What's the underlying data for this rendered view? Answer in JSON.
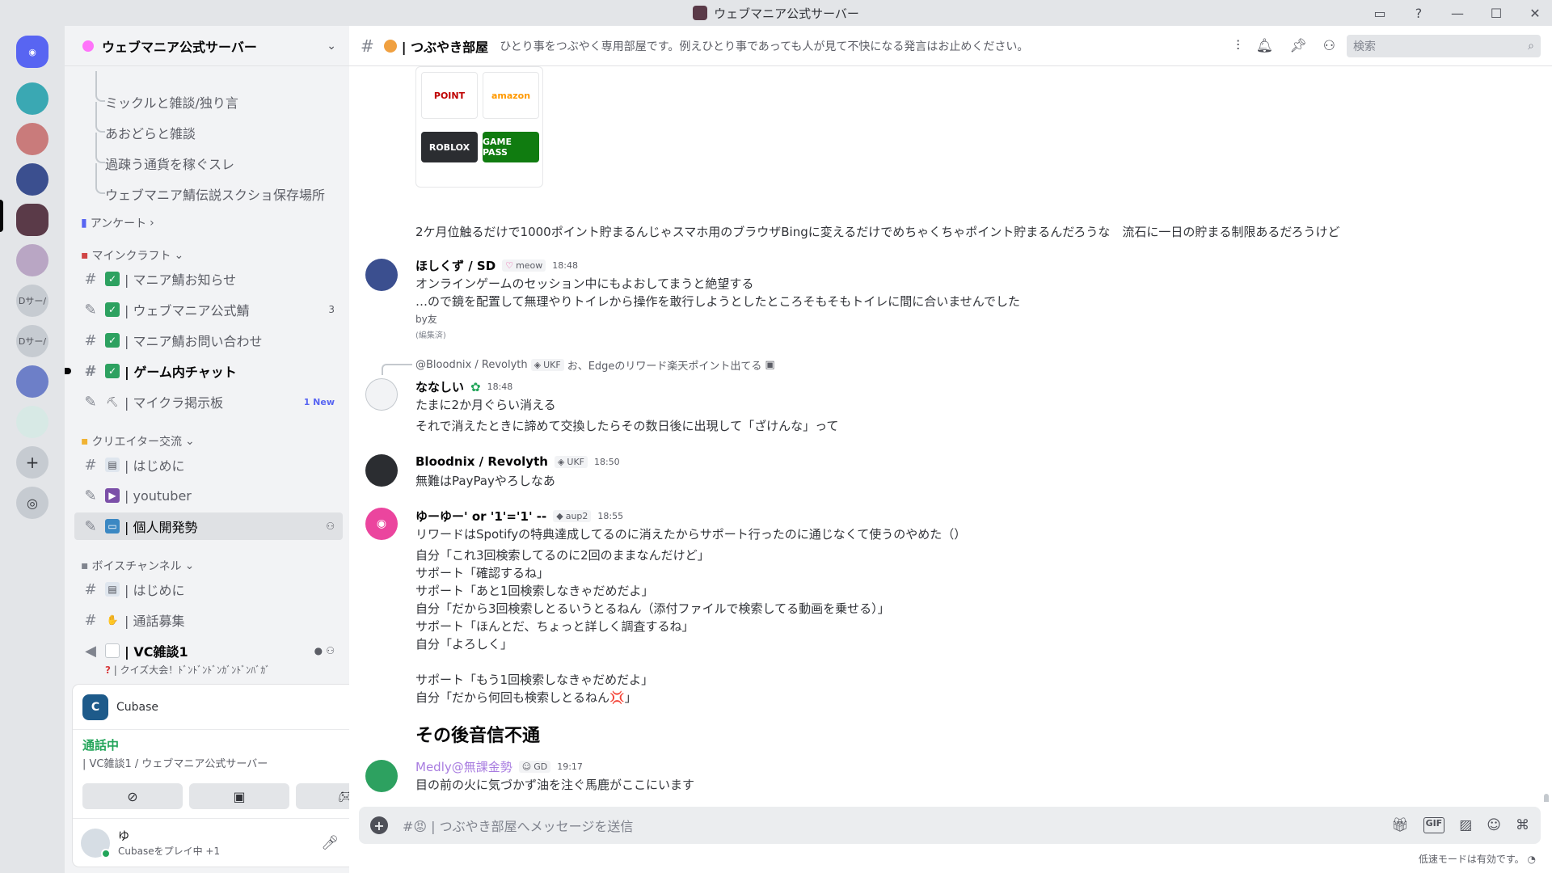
{
  "window": {
    "title": "ウェブマニア公式サーバー"
  },
  "rail": {
    "labels": [
      "Dサー/",
      "Dサー/"
    ]
  },
  "guild": {
    "name": "ウェブマニア公式サーバー"
  },
  "sidebar": {
    "threads": [
      "ミックルと雑談/独り言",
      "あおどらと雑談",
      "過疎う通貨を稼ぐスレ",
      "ウェブマニア鯖伝説スクショ保存場所"
    ],
    "categories": {
      "survey": "アンケート",
      "minecraft": "マインクラフト",
      "creator": "クリエイター交流",
      "voice": "ボイスチャンネル"
    },
    "channels": [
      {
        "name": "| マニア鯖お知らせ"
      },
      {
        "name": "| ウェブマニア公式鯖",
        "badge": "3"
      },
      {
        "name": "| マニア鯖お問い合わせ"
      },
      {
        "name": "| ゲーム内チャット"
      },
      {
        "name": "| マイクラ掲示板",
        "badge": "1 New"
      },
      {
        "name": "| はじめに"
      },
      {
        "name": "| youtuber"
      },
      {
        "name": "| 個人開発勢"
      },
      {
        "name": "| はじめに"
      },
      {
        "name": "| 通話募集"
      },
      {
        "name": "| VC雑談1"
      }
    ],
    "vc_status": "| クイズ大会！ﾄﾞﾝﾄﾞﾝﾄﾞﾝｶﾞﾝﾄﾞﾝﾊﾞｶﾞ"
  },
  "panel": {
    "activity_name": "Cubase",
    "voice_status": "通話中",
    "voice_where": "| VC雑談1 / ウェブマニア公式サーバー",
    "user_name": "ゆ",
    "user_sub": "Cubaseをプレイ中 +1"
  },
  "header": {
    "channel_name": "| つぶやき部屋",
    "topic": "ひとり事をつぶやく専用部屋です。例えひとり事であっても人が見て不快になる発言はお止めください。",
    "search_placeholder": "検索"
  },
  "attachment": {
    "tiles": [
      "POINT",
      "amazon",
      "ROBLOX",
      "GAME PASS"
    ]
  },
  "messages": {
    "m0_text": "2ケ月位触るだけで1000ポイント貯まるんじゃスマホ用のブラウザBingに変えるだけでめちゃくちゃポイント貯まるんだろうな　流石に一日の貯まる制限あるだろうけど",
    "m1": {
      "user": "ほしくず / SD",
      "tag": "meow",
      "time": "18:48",
      "lines": [
        "オンラインゲームのセッション中にもよおしてまうと絶望する",
        "…ので鏡を配置して無理やりトイレから操作を敢行しようとしたところそもそもトイレに間に合いませんでした"
      ],
      "by": "by友",
      "edited": "(編集済)"
    },
    "m2": {
      "reply_user": "@Bloodnix / Revolyth",
      "reply_tag": "UKF",
      "reply_text": "お、Edgeのリワード楽天ポイント出てる",
      "user": "ななしい",
      "time": "18:48",
      "lines": [
        "たまに2か月ぐらい消える",
        "それで消えたときに諦めて交換したらその数日後に出現して「ざけんな」って"
      ]
    },
    "m3": {
      "user": "Bloodnix / Revolyth",
      "tag": "UKF",
      "time": "18:50",
      "lines": [
        "無難はPayPayやろしなあ"
      ]
    },
    "m4": {
      "user": "ゆーゆー' or '1'='1' --",
      "tag": "aup2",
      "time": "18:55",
      "lines": [
        "リワードはSpotifyの特典達成してるのに消えたからサポート行ったのに通じなくて使うのやめた（）",
        "自分「これ3回検索してるのに2回のままなんだけど」",
        "サポート「確認するね」",
        "サポート「あと1回検索しなきゃだめだよ」",
        "自分「だから3回検索しとるいうとるねん（添付ファイルで検索してる動画を乗せる）」",
        "サポート「ほんとだ、ちょっと詳しく調査するね」",
        "自分「よろしく」",
        "サポート「もう1回検索しなきゃだめだよ」",
        "自分「だから何回も検索しとるねん💢」"
      ],
      "heading": "その後音信不通"
    },
    "m5": {
      "user": "Medly@無課金勢",
      "tag": "GD",
      "time": "19:17",
      "lines": [
        "目の前の火に気づかず油を注ぐ馬鹿がここにいます"
      ]
    }
  },
  "composer": {
    "placeholder": "#😡 | つぶやき部屋へメッセージを送信",
    "slow_mode": "低速モードは有効です。"
  },
  "colors": {
    "accent": "#5865f2",
    "online": "#23a55a",
    "medly": "#a87ce0"
  }
}
